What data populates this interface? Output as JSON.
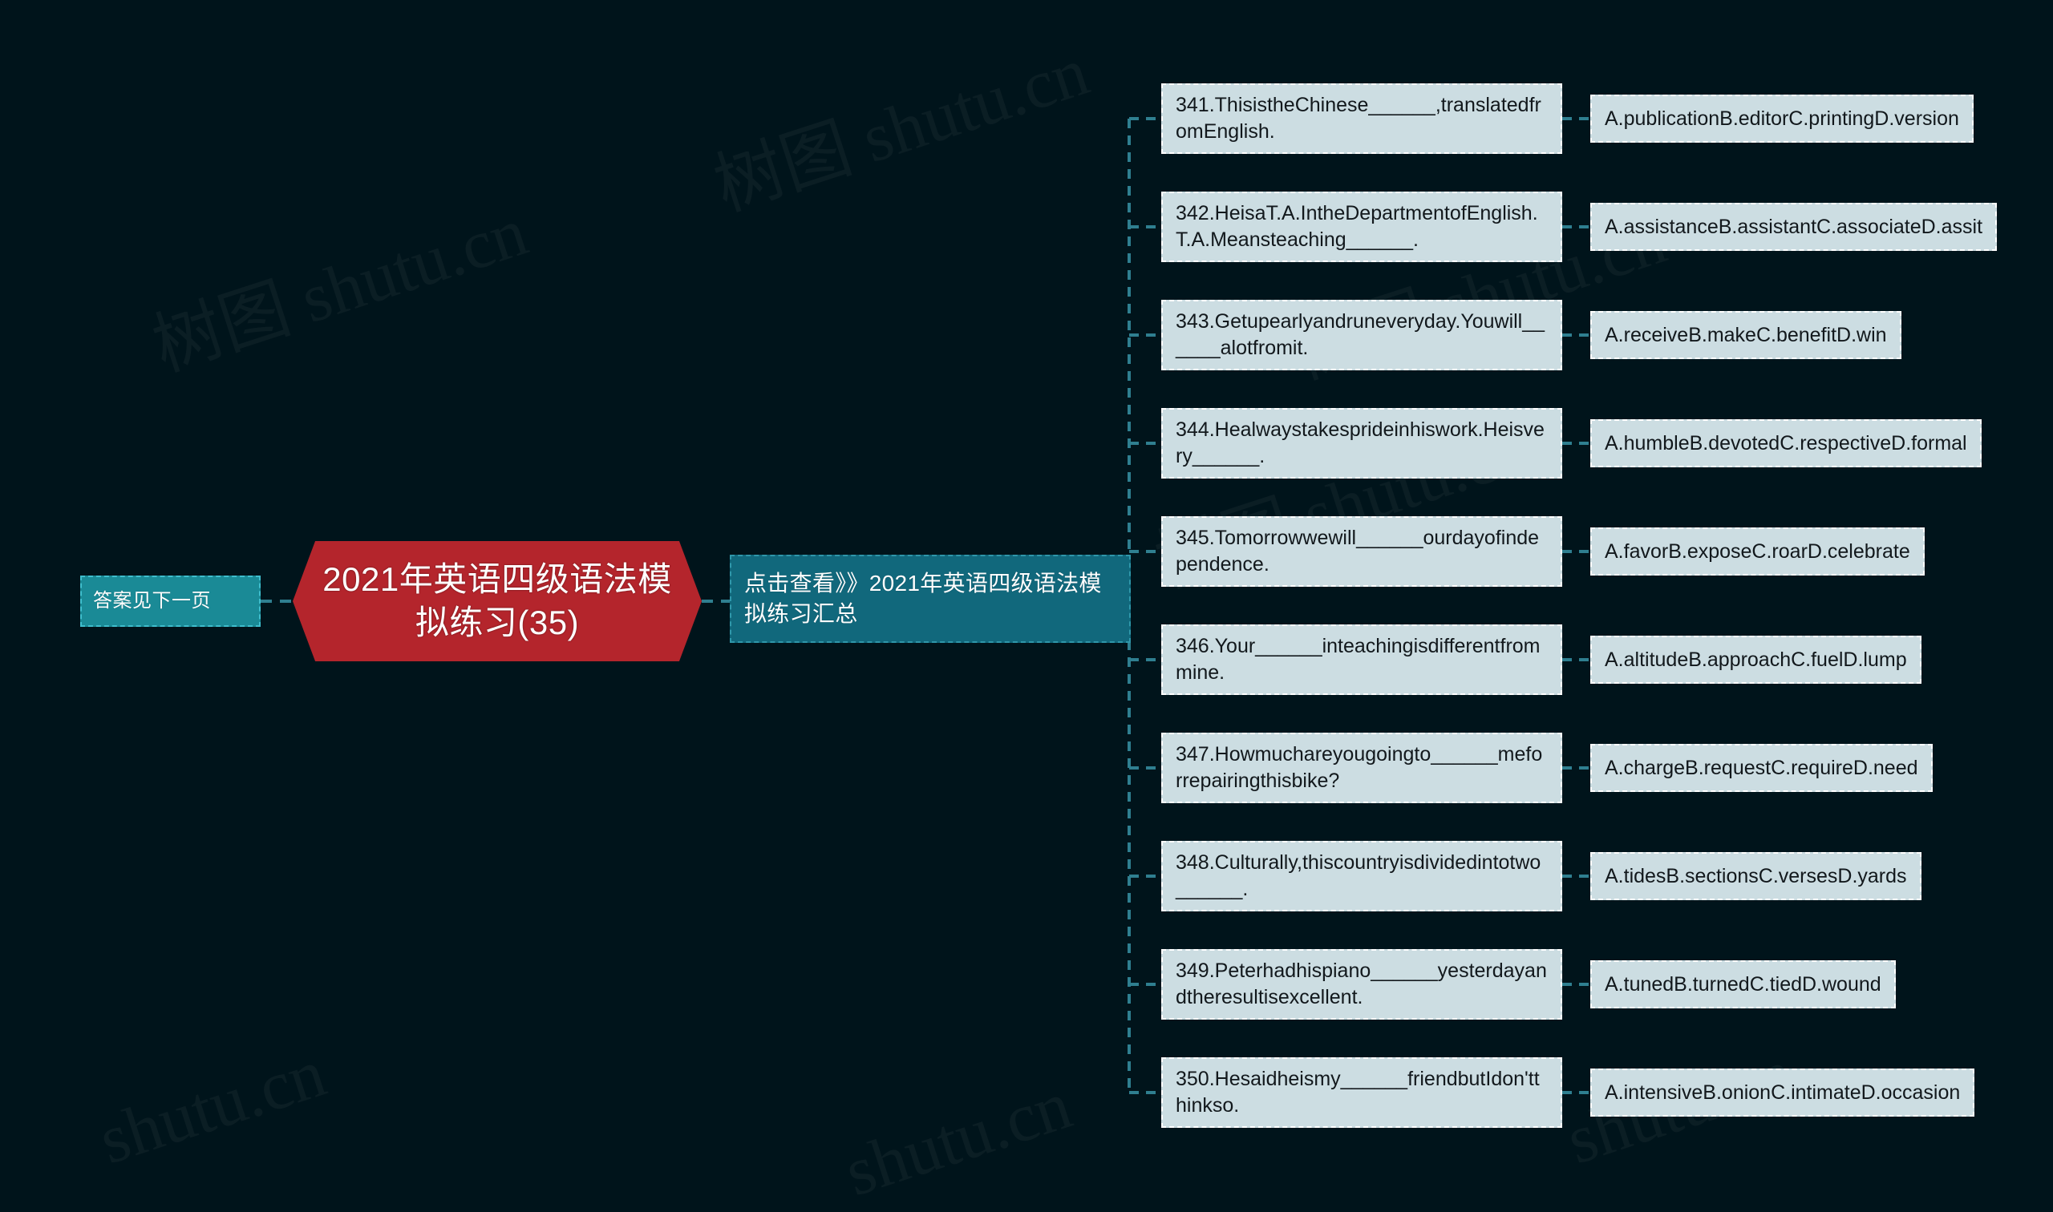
{
  "canvas": {
    "background_color": "#00141b",
    "watermark_text_cn": "树图 shutu.cn",
    "watermark_text_en": "shutu.cn"
  },
  "central_node": {
    "label": "2021年英语四级语法模拟练习(35)",
    "color": "#b4252c",
    "shape": "hexagon"
  },
  "left_node": {
    "label": "答案见下一页",
    "color": "#1a8a96"
  },
  "summary_node": {
    "label": "点击查看》》2021年英语四级语法模拟练习汇总",
    "color": "#11687c"
  },
  "items": [
    {
      "question": "341.ThisistheChinese______,translatedfromEnglish.",
      "answer": "A.publicationB.editorC.printingD.version"
    },
    {
      "question": "342.HeisaT.A.IntheDepartmentofEnglish.T.A.Meansteaching______.",
      "answer": "A.assistanceB.assistantC.associateD.assit"
    },
    {
      "question": "343.Getupearlyandruneveryday.Youwill______alotfromit.",
      "answer": "A.receiveB.makeC.benefitD.win"
    },
    {
      "question": "344.Healwaystakesprideinhiswork.Heisvery______.",
      "answer": "A.humbleB.devotedC.respectiveD.formal"
    },
    {
      "question": "345.Tomorrowwewill______ourdayofindependence.",
      "answer": "A.favorB.exposeC.roarD.celebrate"
    },
    {
      "question": "346.Your______inteachingisdifferentfrommine.",
      "answer": "A.altitudeB.approachC.fuelD.lump"
    },
    {
      "question": "347.Howmuchareyougoingto______meforrepairingthisbike?",
      "answer": "A.chargeB.requestC.requireD.need"
    },
    {
      "question": "348.Culturally,thiscountryisdividedintotwo______.",
      "answer": "A.tidesB.sectionsC.versesD.yards"
    },
    {
      "question": "349.Peterhadhispiano______yesterdayandtheresultisexcellent.",
      "answer": "A.tunedB.turnedC.tiedD.wound"
    },
    {
      "question": "350.Hesaidheismy______friendbutIdon'tthinkso.",
      "answer": "A.intensiveB.onionC.intimateD.occasion"
    }
  ],
  "colors": {
    "branch_line": "#2f7f90",
    "node_fill": "#ccdde2",
    "node_border": "#ffffff"
  }
}
